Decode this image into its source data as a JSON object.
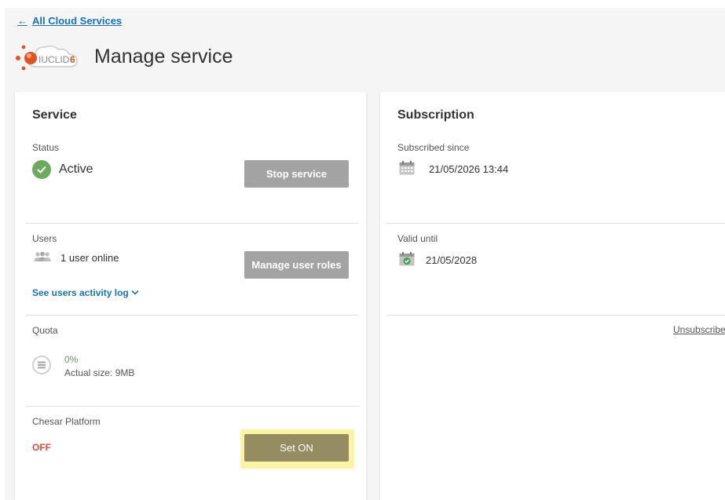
{
  "nav": {
    "back_label": "All Cloud Services"
  },
  "header": {
    "logo_text": "IUCLID6",
    "title": "Manage service"
  },
  "service": {
    "title": "Service",
    "status": {
      "label": "Status",
      "value": "Active",
      "button": "Stop service"
    },
    "users": {
      "label": "Users",
      "online_text": "1 user online",
      "button": "Manage user roles",
      "activity_link": "See users activity log"
    },
    "quota": {
      "label": "Quota",
      "percent": "0%",
      "size": "Actual size: 9MB"
    },
    "chesar": {
      "label": "Chesar Platform",
      "state": "OFF",
      "button": "Set ON"
    }
  },
  "subscription": {
    "title": "Subscription",
    "since": {
      "label": "Subscribed since",
      "value": "21/05/2026 13:44"
    },
    "valid": {
      "label": "Valid until",
      "value": "21/05/2028"
    },
    "unsubscribe": "Unsubscribe"
  },
  "colors": {
    "link": "#1a73b5",
    "active": "#6cab5f",
    "off": "#d44c40",
    "set_on_button": "#958d61",
    "highlight": "#fbf3a6"
  }
}
